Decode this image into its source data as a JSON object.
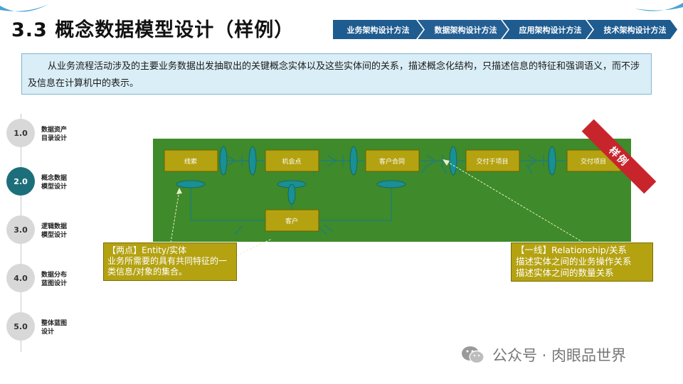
{
  "title": "3.3 概念数据模型设计（样例）",
  "nav": {
    "tabs": [
      {
        "label": "业务架构设计方法"
      },
      {
        "label": "数据架构设计方法"
      },
      {
        "label": "应用架构设计方法"
      },
      {
        "label": "技术架构设计方法"
      }
    ]
  },
  "intro": "从业务流程活动涉及的主要业务数据出发抽取出的关键概念实体以及这些实体间的关系，描述概念化结构，只描述信息的特征和强调语义，而不涉及信息在计算机中的表示。",
  "timeline": [
    {
      "num": "1.0",
      "line1": "数据资产",
      "line2": "目录设计",
      "active": false
    },
    {
      "num": "2.0",
      "line1": "概念数据",
      "line2": "模型设计",
      "active": true
    },
    {
      "num": "3.0",
      "line1": "逻辑数据",
      "line2": "模型设计",
      "active": false
    },
    {
      "num": "4.0",
      "line1": "数据分布",
      "line2": "蓝图设计",
      "active": false
    },
    {
      "num": "5.0",
      "line1": "整体蓝图",
      "line2": "设计",
      "active": false
    }
  ],
  "diagram": {
    "entities": [
      "线索",
      "机会点",
      "客户合同",
      "交付于项目",
      "交付项目",
      "客户"
    ],
    "sample_tag": "样例",
    "callout_entity": {
      "heading": "【两点】Entity/实体",
      "text": "业务所需要的具有共同特征的一类信息/对象的集合。"
    },
    "callout_relationship": {
      "heading": "【一线】Relationship/关系",
      "line1": "描述实体之间的业务操作关系",
      "line2": "描述实体之间的数量关系"
    }
  },
  "watermark": "公众号 · 肉眼品世界",
  "colors": {
    "nav_blue": "#1e5b8f",
    "diagram_green": "#3f8a2a",
    "entity_olive": "#b4a211",
    "connector_teal": "#1a8f95",
    "step_active": "#1c6f7a",
    "ribbon_red": "#c8242c"
  }
}
